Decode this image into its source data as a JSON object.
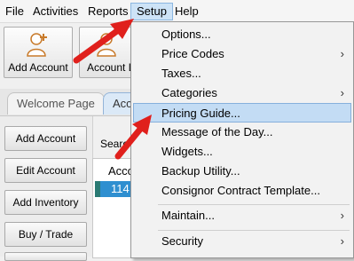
{
  "menubar": {
    "items": [
      {
        "label": "File"
      },
      {
        "label": "Activities"
      },
      {
        "label": "Reports"
      },
      {
        "label": "Setup"
      },
      {
        "label": "Help"
      }
    ]
  },
  "toolbar": {
    "add_account_label": "Add Account",
    "second_label": "Account L"
  },
  "tabs": {
    "welcome": "Welcome Page",
    "second": "Acc"
  },
  "sidebar": {
    "buttons": [
      {
        "label": "Add Account"
      },
      {
        "label": "Edit Account"
      },
      {
        "label": "Add Inventory"
      },
      {
        "label": "Buy / Trade"
      }
    ]
  },
  "main": {
    "search_label": "Searc",
    "column_header": "Acco",
    "selected_row_value": "114"
  },
  "setup_menu": {
    "items": [
      {
        "label": "Options...",
        "submenu": false
      },
      {
        "label": "Price Codes",
        "submenu": true
      },
      {
        "label": "Taxes...",
        "submenu": false
      },
      {
        "label": "Categories",
        "submenu": true
      },
      {
        "label": "Pricing Guide...",
        "submenu": false,
        "highlighted": true
      },
      {
        "label": "Message of the Day...",
        "submenu": false
      },
      {
        "label": "Widgets...",
        "submenu": false
      },
      {
        "label": "Backup Utility...",
        "submenu": false
      },
      {
        "label": "Consignor Contract Template...",
        "submenu": false
      },
      {
        "label": "Maintain...",
        "submenu": true
      },
      {
        "label": "Security",
        "submenu": true
      }
    ],
    "submenu_glyph": "›"
  },
  "colors": {
    "highlight": "#c3dcf4",
    "arrow": "#e0201c",
    "selected_row": "#2f8fd0"
  }
}
